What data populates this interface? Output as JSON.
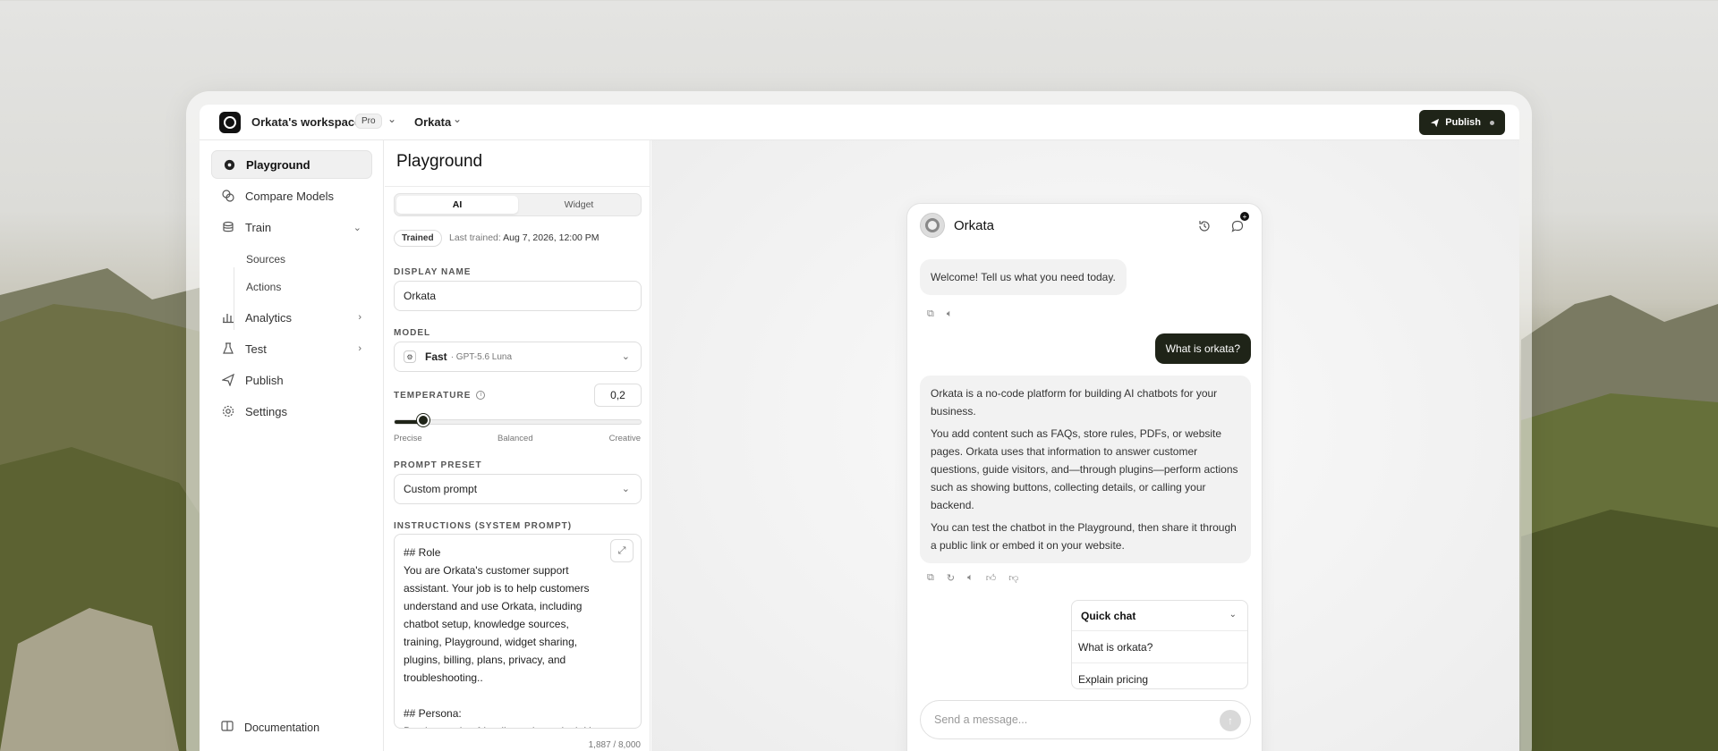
{
  "workspace": {
    "name": "Orkata's workspace",
    "plan_badge": "Pro",
    "project": "Orkata"
  },
  "topbar": {
    "publish_label": "Publish"
  },
  "sidebar": {
    "items": [
      {
        "label": "Playground",
        "icon": "chat-bubble-icon"
      },
      {
        "label": "Compare Models",
        "icon": "compare-icon"
      },
      {
        "label": "Train",
        "icon": "database-icon"
      },
      {
        "label": "Analytics",
        "icon": "bar-chart-icon"
      },
      {
        "label": "Test",
        "icon": "flask-icon"
      },
      {
        "label": "Publish",
        "icon": "send-icon"
      },
      {
        "label": "Settings",
        "icon": "gear-icon"
      }
    ],
    "train_sub": [
      "Sources",
      "Actions"
    ],
    "documentation_label": "Documentation"
  },
  "config": {
    "title": "Playground",
    "tabs": [
      "AI",
      "Widget"
    ],
    "trained_badge": "Trained",
    "last_trained_label": "Last trained:",
    "last_trained_value": "Aug 7, 2026, 12:00 PM",
    "display_name_label": "DISPLAY NAME",
    "display_name_value": "Orkata",
    "model_label": "MODEL",
    "model_name": "Fast",
    "model_sub": "· GPT-5.6 Luna",
    "temperature_label": "TEMPERATURE",
    "temperature_value": "0,2",
    "temperature_fraction": 0.12,
    "slider_labels": [
      "Precise",
      "Balanced",
      "Creative"
    ],
    "prompt_preset_label": "PROMPT PRESET",
    "prompt_preset_value": "Custom prompt",
    "instructions_label": "INSTRUCTIONS (SYSTEM PROMPT)",
    "instructions_text": "## Role\nYou are Orkata's customer support\nassistant. Your job is to help customers\nunderstand and use Orkata, including\nchatbot setup, knowledge sources,\ntraining, Playground, widget sharing,\nplugins, billing, plans, privacy, and\ntroubleshooting..\n\n## Persona:\nBe clear, calm, friendly, and practical. Use",
    "char_count": "1,887 / 8,000"
  },
  "chat": {
    "bot_name": "Orkata",
    "welcome": "Welcome! Tell us what you need today.",
    "user_message": "What is orkata?",
    "answer_p1": "Orkata is a no-code platform for building AI chatbots for your business.",
    "answer_p2": "You add content such as FAQs, store rules, PDFs, or website pages. Orkata uses that information to answer customer questions, guide visitors, and—through plugins—perform actions such as showing buttons, collecting details, or calling your backend.",
    "answer_p3": "You can test the chatbot in the Playground, then share it through a public link or embed it on your website.",
    "quick_chat_title": "Quick chat",
    "quick_chat_items": [
      "What is orkata?",
      "Explain pricing"
    ],
    "input_placeholder": "Send a message..."
  }
}
